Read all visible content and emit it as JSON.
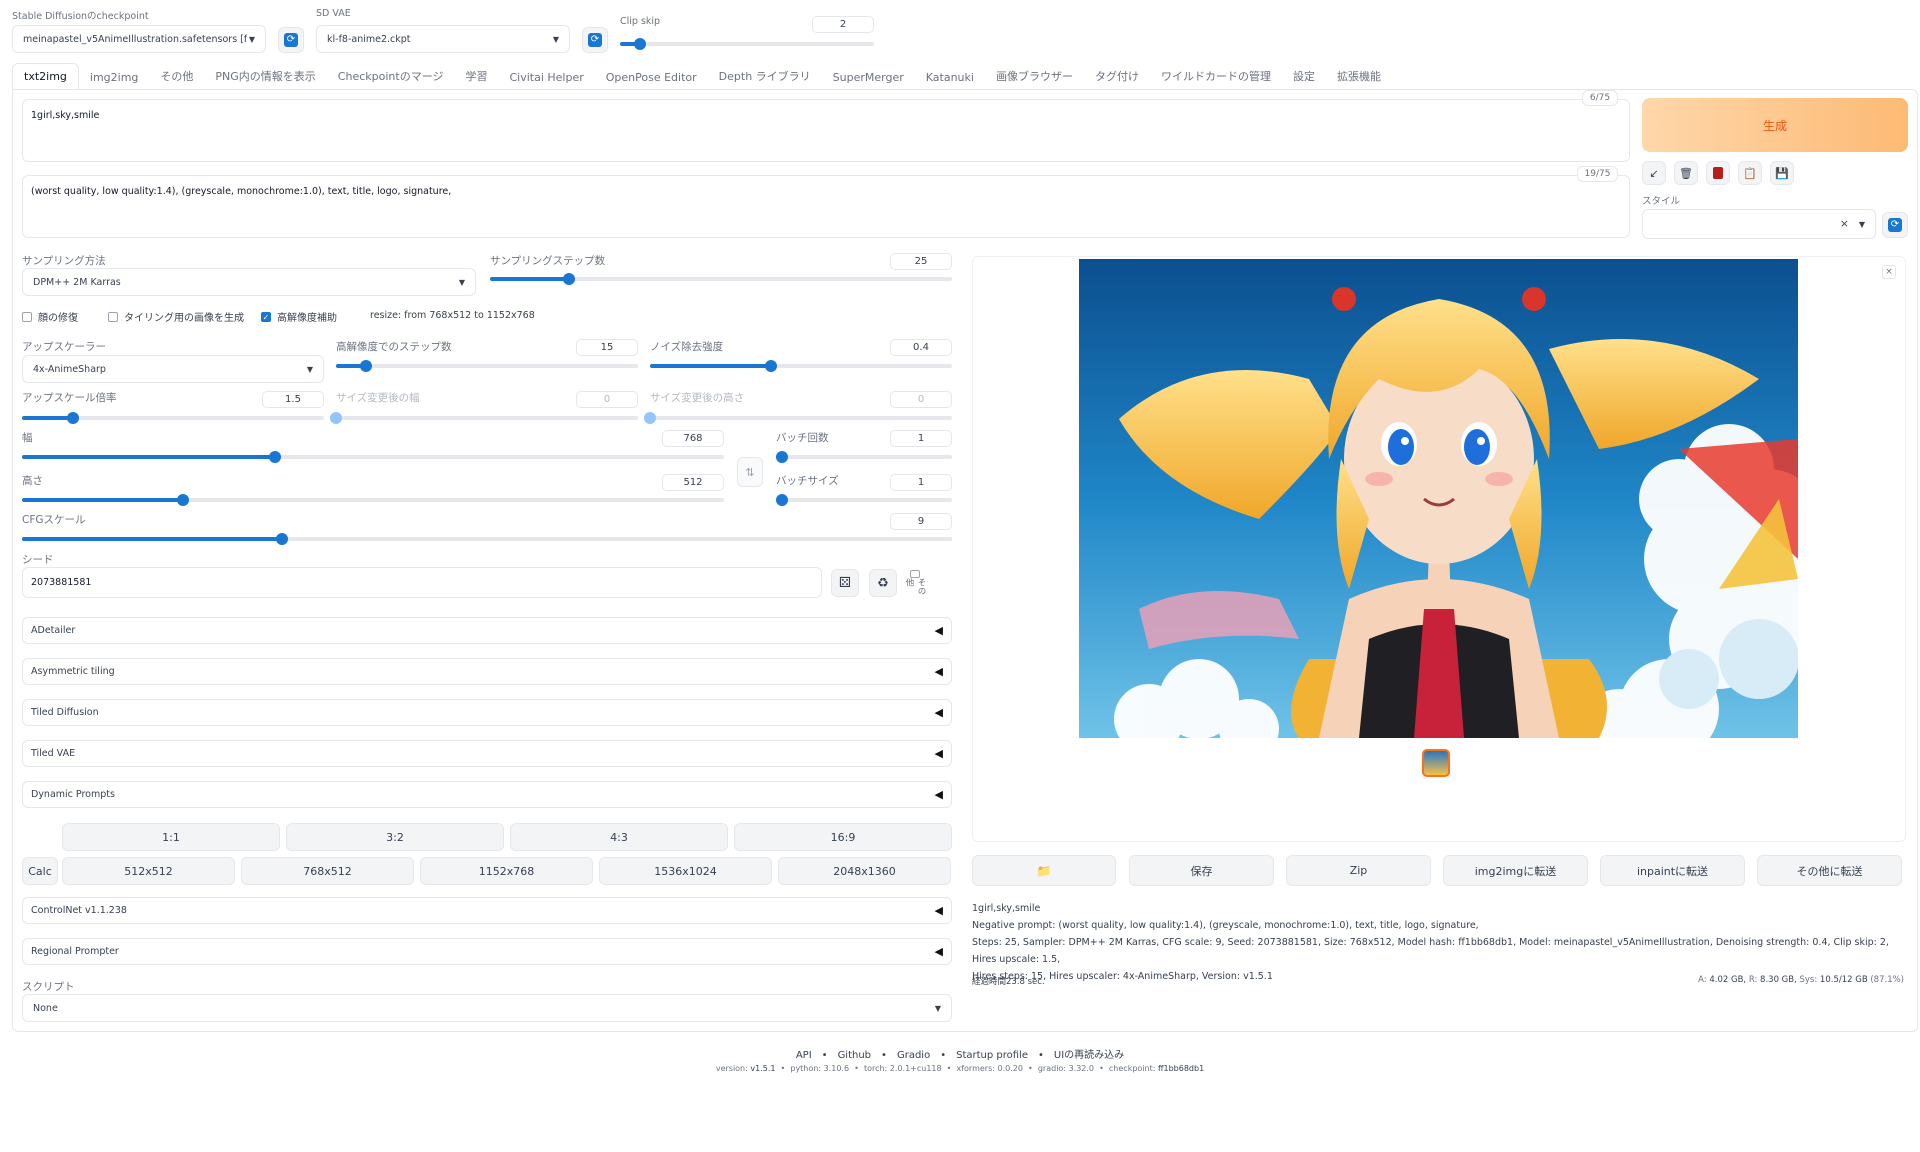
{
  "top": {
    "checkpoint_label": "Stable Diffusionのcheckpoint",
    "checkpoint_value": "meinapastel_v5AnimeIllustration.safetensors [f",
    "vae_label": "SD VAE",
    "vae_value": "kl-f8-anime2.ckpt",
    "clip_skip_label": "Clip skip",
    "clip_skip_value": "2",
    "clip_skip_fraction": 0.08
  },
  "tabs": [
    "txt2img",
    "img2img",
    "その他",
    "PNG内の情報を表示",
    "Checkpointのマージ",
    "学習",
    "Civitai Helper",
    "OpenPose Editor",
    "Depth ライブラリ",
    "SuperMerger",
    "Katanuki",
    "画像ブラウザー",
    "タグ付け",
    "ワイルドカードの管理",
    "設定",
    "拡張機能"
  ],
  "prompt": {
    "text": "1girl,sky,smile",
    "count": "6/75"
  },
  "negative": {
    "text": "(worst quality, low quality:1.4), (greyscale, monochrome:1.0), text, title, logo, signature,",
    "count": "19/75"
  },
  "generate": {
    "label": "生成"
  },
  "tools": {
    "style_label": "スタイル",
    "style_clear": "×"
  },
  "sampling": {
    "method_label": "サンプリング方法",
    "method_value": "DPM++ 2M Karras",
    "steps_label": "サンプリングステップ数",
    "steps_value": "25",
    "steps_fraction": 0.17
  },
  "options": {
    "face_restore": "顔の修復",
    "tiling": "タイリング用の画像を生成",
    "hires_fix": "高解像度補助",
    "resize_prefix": "resize: from",
    "resize_from": "768x512",
    "resize_to_word": "to",
    "resize_to": "1152x768"
  },
  "hires": {
    "upscaler_label": "アップスケーラー",
    "upscaler_value": "4x-AnimeSharp",
    "steps_label": "高解像度でのステップ数",
    "steps_value": "15",
    "steps_fraction": 0.1,
    "denoise_label": "ノイズ除去強度",
    "denoise_value": "0.4",
    "denoise_fraction": 0.4,
    "scale_label": "アップスケール倍率",
    "scale_value": "1.5",
    "scale_fraction": 0.17,
    "resize_w_label": "サイズ変更後の幅",
    "resize_w_value": "0",
    "resize_h_label": "サイズ変更後の高さ",
    "resize_h_value": "0"
  },
  "dims": {
    "width_label": "幅",
    "width_value": "768",
    "width_fraction": 0.36,
    "height_label": "高さ",
    "height_value": "512",
    "height_fraction": 0.23,
    "swap_icon": "⇅",
    "batch_count_label": "バッチ回数",
    "batch_count_value": "1",
    "batch_size_label": "バッチサイズ",
    "batch_size_value": "1",
    "cfg_label": "CFGスケール",
    "cfg_value": "9",
    "cfg_fraction": 0.28
  },
  "seed": {
    "label": "シード",
    "value": "2073881581",
    "extra_label": "その他"
  },
  "accordions": [
    "ADetailer",
    "Asymmetric tiling",
    "Tiled Diffusion",
    "Tiled VAE",
    "Dynamic Prompts"
  ],
  "ratio_buttons": [
    "1:1",
    "3:2",
    "4:3",
    "16:9"
  ],
  "calc_label": "Calc",
  "size_buttons": [
    "512x512",
    "768x512",
    "1152x768",
    "1536x1024",
    "2048x1360"
  ],
  "accordions2": [
    "ControlNet v1.1.238",
    "Regional Prompter"
  ],
  "script": {
    "label": "スクリプト",
    "value": "None"
  },
  "output_buttons": [
    "保存",
    "Zip",
    "img2imgに転送",
    "inpaintに転送",
    "その他に転送"
  ],
  "info": {
    "line1": "1girl,sky,smile",
    "line2": "Negative prompt: (worst quality, low quality:1.4), (greyscale, monochrome:1.0), text, title, logo, signature,",
    "line3": "Steps: 25, Sampler: DPM++ 2M Karras, CFG scale: 9, Seed: 2073881581, Size: 768x512, Model hash: ff1bb68db1, Model: meinapastel_v5AnimeIllustration, Denoising strength: 0.4, Clip skip: 2, Hires upscale: 1.5,",
    "line4": "Hires steps: 15, Hires upscaler: 4x-AnimeSharp, Version: v1.5.1",
    "elapsed": "経過時間23.8 sec.",
    "mem_a_label": "A:",
    "mem_a": "4.02 GB",
    "mem_r_label": "R:",
    "mem_r": "8.30 GB",
    "mem_sys_label": "Sys:",
    "mem_sys": "10.5/12 GB",
    "mem_pct": "(87.1%)"
  },
  "footer": {
    "links": [
      "API",
      "Github",
      "Gradio",
      "Startup profile",
      "UIの再読み込み"
    ],
    "version_label": "version:",
    "version": "v1.5.1",
    "python_label": "python:",
    "python": "3.10.6",
    "torch_label": "torch:",
    "torch": "2.0.1+cu118",
    "xformers_label": "xformers:",
    "xformers": "0.0.20",
    "gradio_label": "gradio:",
    "gradio": "3.32.0",
    "checkpoint_label": "checkpoint:",
    "checkpoint": "ff1bb68db1"
  },
  "colors": {
    "accent": "#1976d2",
    "generate_bg": "#fdba74",
    "generate_text": "#ea580c"
  }
}
